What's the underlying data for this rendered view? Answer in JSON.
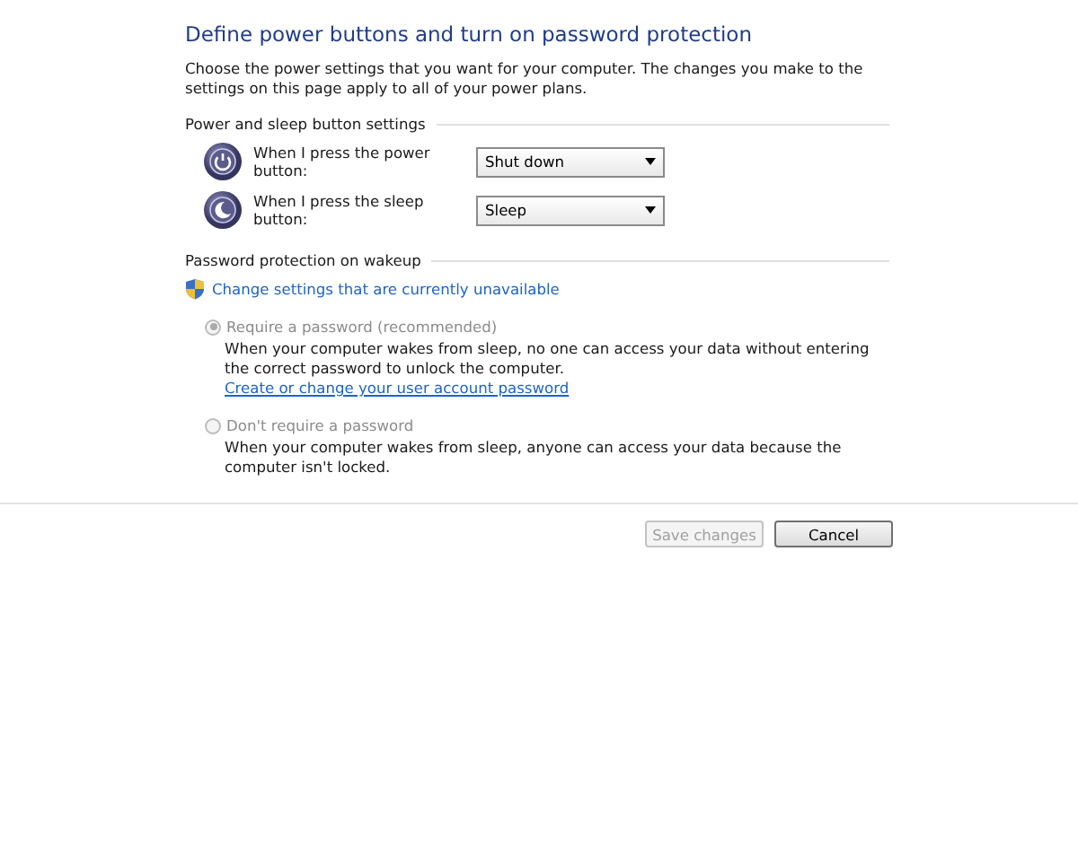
{
  "title": "Define power buttons and turn on password protection",
  "intro": "Choose the power settings that you want for your computer. The changes you make to the settings on this page apply to all of your power plans.",
  "button_settings": {
    "heading": "Power and sleep button settings",
    "rows": [
      {
        "kind": "power",
        "label": "When I press the power button:",
        "value": "Shut down"
      },
      {
        "kind": "sleep",
        "label": "When I press the sleep button:",
        "value": "Sleep"
      }
    ]
  },
  "password": {
    "heading": "Password protection on wakeup",
    "shield_link": "Change settings that are currently unavailable",
    "options": [
      {
        "label": "Require a password (recommended)",
        "selected": true,
        "disabled": true,
        "description": "When your computer wakes from sleep, no one can access your data without entering the correct password to unlock the computer.",
        "link": "Create or change your user account password"
      },
      {
        "label": "Don't require a password",
        "selected": false,
        "disabled": true,
        "description": "When your computer wakes from sleep, anyone can access your data because the computer isn't locked."
      }
    ]
  },
  "buttons": [
    {
      "label": "Save changes",
      "disabled": true
    },
    {
      "label": "Cancel",
      "disabled": false
    }
  ]
}
